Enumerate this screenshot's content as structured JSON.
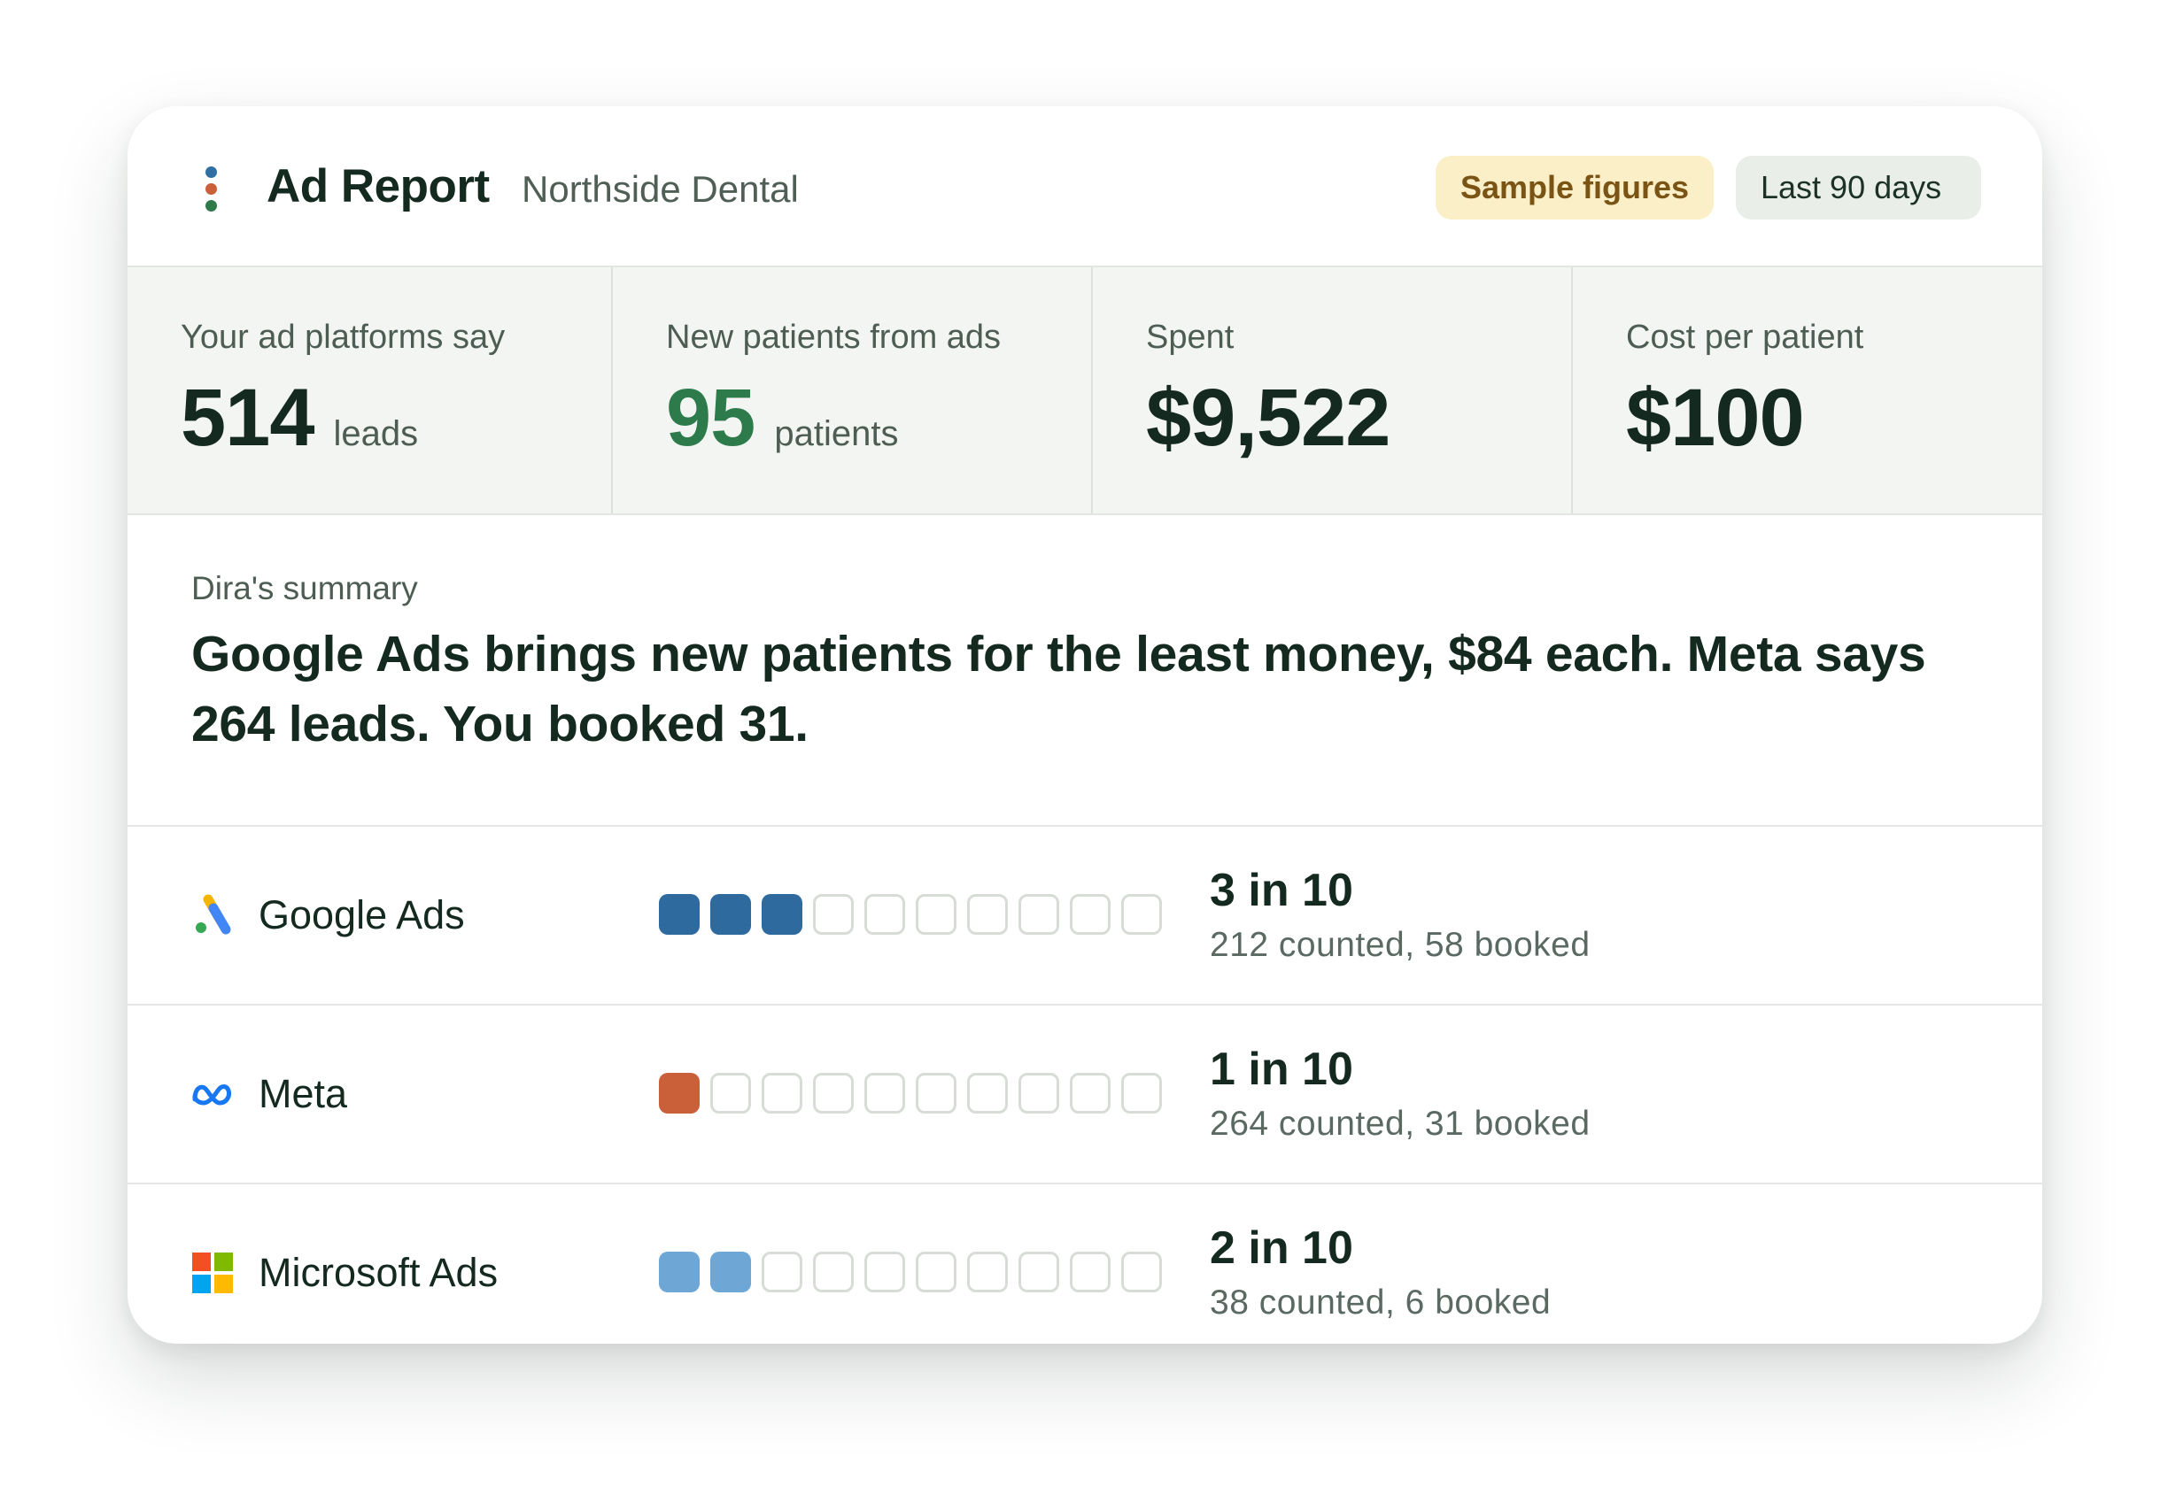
{
  "header": {
    "title": "Ad Report",
    "subtitle": "Northside Dental",
    "badge_sample": "Sample figures",
    "badge_range": "Last 90 days",
    "logo_colors": [
      "#2f6fa3",
      "#c9603a",
      "#2d7a4b"
    ]
  },
  "metrics": [
    {
      "label": "Your ad platforms say",
      "value": "514",
      "unit": "leads"
    },
    {
      "label": "New patients from ads",
      "value": "95",
      "unit": "patients",
      "accent": "#2d7a4b"
    },
    {
      "label": "Spent",
      "value": "$9,522",
      "unit": ""
    },
    {
      "label": "Cost per patient",
      "value": "$100",
      "unit": ""
    }
  ],
  "summary": {
    "label": "Dira's summary",
    "text": "Google Ads brings new patients for the least money, $84 each. Meta says 264 leads. You booked 31."
  },
  "platforms": [
    {
      "name": "Google Ads",
      "icon": "google-ads-icon",
      "ratio": "3 in 10",
      "filled": 3,
      "total": 10,
      "color": "#2f6a9e",
      "detail": "212 counted, 58 booked"
    },
    {
      "name": "Meta",
      "icon": "meta-icon",
      "ratio": "1 in 10",
      "filled": 1,
      "total": 10,
      "color": "#c9603a",
      "detail": "264 counted, 31 booked"
    },
    {
      "name": "Microsoft Ads",
      "icon": "microsoft-icon",
      "ratio": "2 in 10",
      "filled": 2,
      "total": 10,
      "color": "#6ea6d6",
      "detail": "38 counted, 6 booked"
    }
  ]
}
